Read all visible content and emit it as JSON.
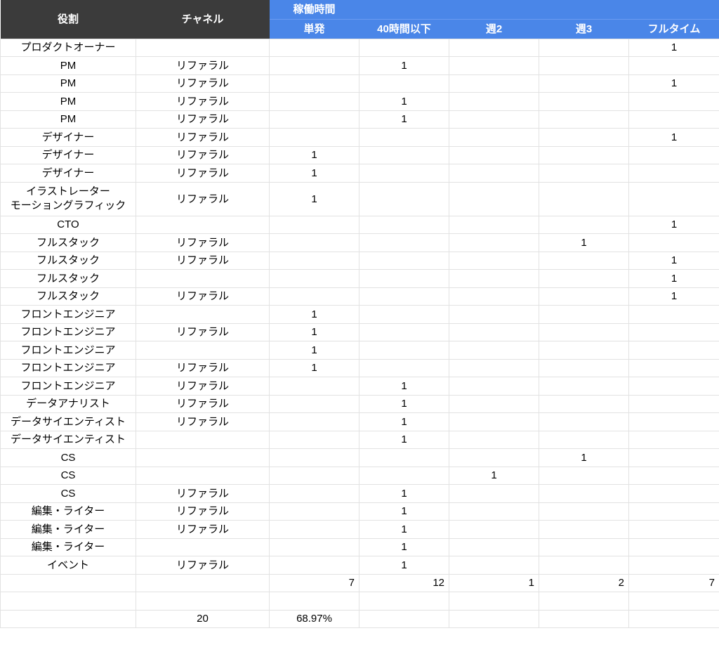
{
  "headers": {
    "role": "役割",
    "channel": "チャネル",
    "hours_group": "稼働時間",
    "single": "単発",
    "under40": "40時間以下",
    "week2": "週2",
    "week3": "週3",
    "fulltime": "フルタイム"
  },
  "rows": [
    {
      "role": "プロダクトオーナー",
      "channel": "",
      "single": "",
      "under40": "",
      "week2": "",
      "week3": "",
      "fulltime": "1"
    },
    {
      "role": "PM",
      "channel": "リファラル",
      "single": "",
      "under40": "1",
      "week2": "",
      "week3": "",
      "fulltime": ""
    },
    {
      "role": "PM",
      "channel": "リファラル",
      "single": "",
      "under40": "",
      "week2": "",
      "week3": "",
      "fulltime": "1"
    },
    {
      "role": "PM",
      "channel": "リファラル",
      "single": "",
      "under40": "1",
      "week2": "",
      "week3": "",
      "fulltime": ""
    },
    {
      "role": "PM",
      "channel": "リファラル",
      "single": "",
      "under40": "1",
      "week2": "",
      "week3": "",
      "fulltime": ""
    },
    {
      "role": "デザイナー",
      "channel": "リファラル",
      "single": "",
      "under40": "",
      "week2": "",
      "week3": "",
      "fulltime": "1"
    },
    {
      "role": "デザイナー",
      "channel": "リファラル",
      "single": "1",
      "under40": "",
      "week2": "",
      "week3": "",
      "fulltime": ""
    },
    {
      "role": "デザイナー",
      "channel": "リファラル",
      "single": "1",
      "under40": "",
      "week2": "",
      "week3": "",
      "fulltime": ""
    },
    {
      "role": "イラストレーター",
      "role2": "モーショングラフィック",
      "channel": "リファラル",
      "single": "1",
      "under40": "",
      "week2": "",
      "week3": "",
      "fulltime": ""
    },
    {
      "role": "CTO",
      "channel": "",
      "single": "",
      "under40": "",
      "week2": "",
      "week3": "",
      "fulltime": "1"
    },
    {
      "role": "フルスタック",
      "channel": "リファラル",
      "single": "",
      "under40": "",
      "week2": "",
      "week3": "1",
      "fulltime": ""
    },
    {
      "role": "フルスタック",
      "channel": "リファラル",
      "single": "",
      "under40": "",
      "week2": "",
      "week3": "",
      "fulltime": "1"
    },
    {
      "role": "フルスタック",
      "channel": "",
      "single": "",
      "under40": "",
      "week2": "",
      "week3": "",
      "fulltime": "1"
    },
    {
      "role": "フルスタック",
      "channel": "リファラル",
      "single": "",
      "under40": "",
      "week2": "",
      "week3": "",
      "fulltime": "1"
    },
    {
      "role": "フロントエンジニア",
      "channel": "",
      "single": "1",
      "under40": "",
      "week2": "",
      "week3": "",
      "fulltime": ""
    },
    {
      "role": "フロントエンジニア",
      "channel": "リファラル",
      "single": "1",
      "under40": "",
      "week2": "",
      "week3": "",
      "fulltime": ""
    },
    {
      "role": "フロントエンジニア",
      "channel": "",
      "single": "1",
      "under40": "",
      "week2": "",
      "week3": "",
      "fulltime": ""
    },
    {
      "role": "フロントエンジニア",
      "channel": "リファラル",
      "single": "1",
      "under40": "",
      "week2": "",
      "week3": "",
      "fulltime": ""
    },
    {
      "role": "フロントエンジニア",
      "channel": "リファラル",
      "single": "",
      "under40": "1",
      "week2": "",
      "week3": "",
      "fulltime": ""
    },
    {
      "role": "データアナリスト",
      "channel": "リファラル",
      "single": "",
      "under40": "1",
      "week2": "",
      "week3": "",
      "fulltime": ""
    },
    {
      "role": "データサイエンティスト",
      "channel": "リファラル",
      "single": "",
      "under40": "1",
      "week2": "",
      "week3": "",
      "fulltime": ""
    },
    {
      "role": "データサイエンティスト",
      "channel": "",
      "single": "",
      "under40": "1",
      "week2": "",
      "week3": "",
      "fulltime": ""
    },
    {
      "role": "CS",
      "channel": "",
      "single": "",
      "under40": "",
      "week2": "",
      "week3": "1",
      "fulltime": ""
    },
    {
      "role": "CS",
      "channel": "",
      "single": "",
      "under40": "",
      "week2": "1",
      "week3": "",
      "fulltime": ""
    },
    {
      "role": "CS",
      "channel": "リファラル",
      "single": "",
      "under40": "1",
      "week2": "",
      "week3": "",
      "fulltime": ""
    },
    {
      "role": "編集・ライター",
      "channel": "リファラル",
      "single": "",
      "under40": "1",
      "week2": "",
      "week3": "",
      "fulltime": ""
    },
    {
      "role": "編集・ライター",
      "channel": "リファラル",
      "single": "",
      "under40": "1",
      "week2": "",
      "week3": "",
      "fulltime": ""
    },
    {
      "role": "編集・ライター",
      "channel": "",
      "single": "",
      "under40": "1",
      "week2": "",
      "week3": "",
      "fulltime": ""
    },
    {
      "role": "イベント",
      "channel": "リファラル",
      "single": "",
      "under40": "1",
      "week2": "",
      "week3": "",
      "fulltime": ""
    }
  ],
  "totals": {
    "single": "7",
    "under40": "12",
    "week2": "1",
    "week3": "2",
    "fulltime": "7"
  },
  "summary": {
    "count": "20",
    "percent": "68.97%"
  },
  "colors": {
    "header_dark": "#3b3b3b",
    "header_blue": "#4a86e8",
    "grid": "#e2e2e2"
  }
}
